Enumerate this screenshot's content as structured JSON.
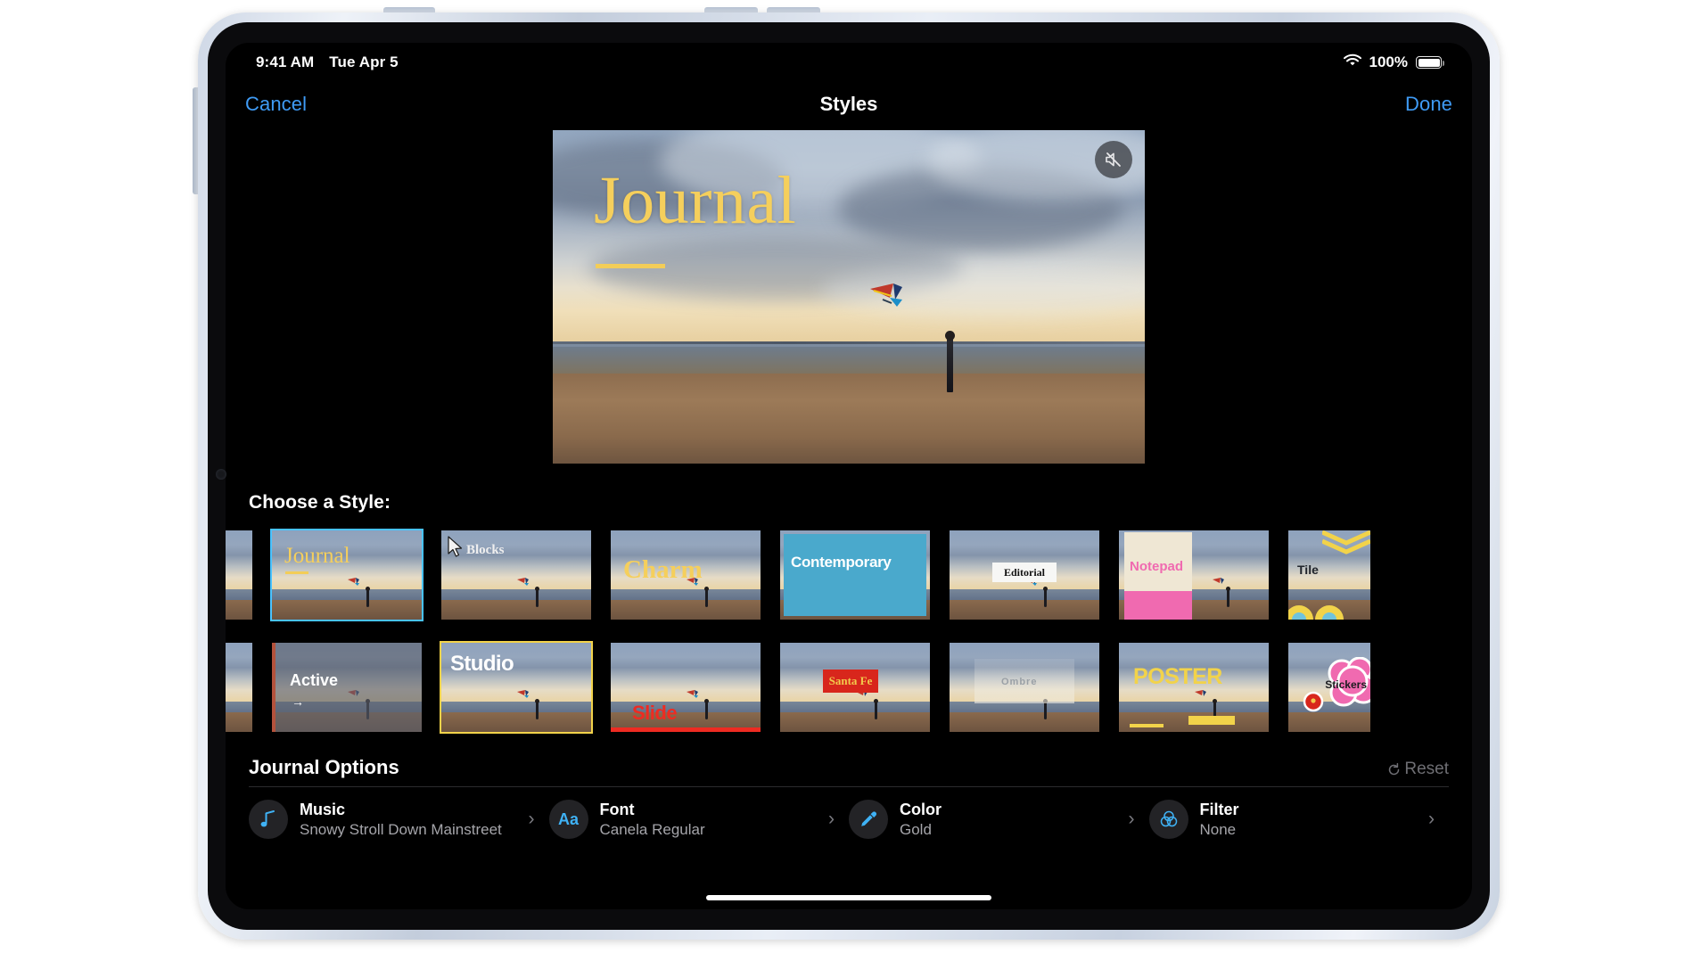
{
  "status_bar": {
    "time": "9:41 AM",
    "date": "Tue Apr 5",
    "battery_percent": "100%",
    "wifi_icon": "wifi-icon",
    "battery_icon": "battery-icon"
  },
  "nav": {
    "cancel_label": "Cancel",
    "title": "Styles",
    "done_label": "Done",
    "accent_color": "#3f9bf5"
  },
  "preview": {
    "title_text": "Journal",
    "title_color": "#f5cf5c",
    "mute_icon": "speaker-slash-icon"
  },
  "styles": {
    "section_label": "Choose a Style:",
    "selected": "Journal",
    "selection_color": "#49c3ff",
    "row1": [
      {
        "name": "",
        "partial": true
      },
      {
        "name": "Journal",
        "selected": true
      },
      {
        "name": "Blocks"
      },
      {
        "name": "Charm"
      },
      {
        "name": "Contemporary"
      },
      {
        "name": "Editorial"
      },
      {
        "name": "Notepad"
      },
      {
        "name": "Tile",
        "partial": true
      }
    ],
    "row2": [
      {
        "name": "",
        "partial": true
      },
      {
        "name": "Active"
      },
      {
        "name": "Studio"
      },
      {
        "name": "Slide"
      },
      {
        "name": "Santa Fe"
      },
      {
        "name": "Ombre"
      },
      {
        "name": "POSTER"
      },
      {
        "name": "Stickers",
        "partial": true
      }
    ]
  },
  "options": {
    "title": "Journal Options",
    "reset_label": "Reset",
    "reset_icon": "reset-circular-arrow-icon",
    "items": [
      {
        "icon": "music-note-icon",
        "label": "Music",
        "value": "Snowy Stroll Down Mainstreet"
      },
      {
        "icon": "font-aa-icon",
        "label": "Font",
        "value": "Canela Regular"
      },
      {
        "icon": "eyedropper-icon",
        "label": "Color",
        "value": "Gold"
      },
      {
        "icon": "filter-circles-icon",
        "label": "Filter",
        "value": "None"
      }
    ],
    "chevron_icon": "chevron-right-icon"
  },
  "home_indicator": "home-indicator-bar"
}
